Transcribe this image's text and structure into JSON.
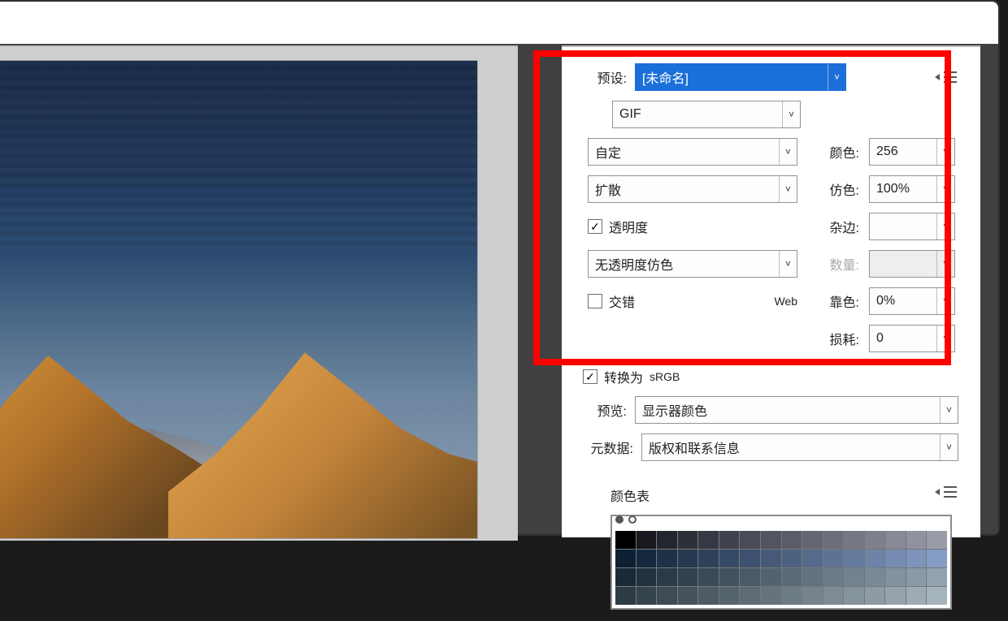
{
  "panel": {
    "preset_label": "预设:",
    "preset_value": "[未命名]",
    "format_value": "GIF",
    "palette_value": "自定",
    "colors_label": "颜色:",
    "colors_value": "256",
    "dither_value": "扩散",
    "dither_amt_label": "仿色:",
    "dither_amt_value": "100%",
    "transparency_label": "透明度",
    "matte_label": "杂边:",
    "matte_value": "",
    "trans_dither_value": "无透明度仿色",
    "trans_amt_label": "数量:",
    "trans_amt_value": "",
    "interlace_label": "交错",
    "web_label": "Web",
    "websnap_label": "靠色:",
    "websnap_value": "0%",
    "lossy_label": "损耗:",
    "lossy_value": "0",
    "convert_label": "转换为",
    "convert_value": "sRGB",
    "preview_label": "预览:",
    "preview_value": "显示器颜色",
    "metadata_label": "元数据:",
    "metadata_value": "版权和联系信息",
    "color_table_title": "颜色表"
  },
  "swatch_colors": [
    "#000000",
    "#18191e",
    "#24262f",
    "#2d3039",
    "#363943",
    "#40434d",
    "#494c57",
    "#525560",
    "#5a5d69",
    "#636672",
    "#6c6f7b",
    "#757883",
    "#7e818c",
    "#878a95",
    "#90939e",
    "#999ca7",
    "#0d2034",
    "#15283d",
    "#1d3147",
    "#253951",
    "#2d415b",
    "#354a64",
    "#3d526e",
    "#455a78",
    "#4d6281",
    "#556b8b",
    "#5d7395",
    "#657b9e",
    "#6d84a8",
    "#758cb2",
    "#7d94bb",
    "#859dc5",
    "#1a2a36",
    "#22323e",
    "#2a3a46",
    "#32424e",
    "#3a4a56",
    "#42525e",
    "#4a5a66",
    "#52626e",
    "#5a6a76",
    "#62727e",
    "#6a7a86",
    "#72828e",
    "#7a8a96",
    "#82929e",
    "#8a9aa6",
    "#92a2ae",
    "#2d3c44",
    "#35444c",
    "#3d4c54",
    "#45545c",
    "#4d5c64",
    "#55646c",
    "#5d6c74",
    "#65747c",
    "#6d7c84",
    "#75848c",
    "#7d8c94",
    "#85949c",
    "#8d9ca4",
    "#95a4ac",
    "#9dacb4",
    "#a5b4bc"
  ]
}
